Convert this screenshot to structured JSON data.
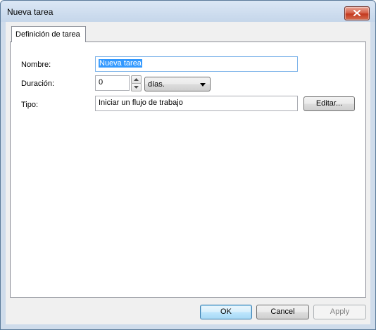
{
  "window": {
    "title": "Nueva tarea"
  },
  "tabs": [
    {
      "label": "Definición de tarea"
    }
  ],
  "form": {
    "nombre_label": "Nombre:",
    "nombre_value": "Nueva tarea",
    "duracion_label": "Duración:",
    "duracion_value": "0",
    "duracion_unit": "días.",
    "tipo_label": "Tipo:",
    "tipo_value": "Iniciar un flujo de trabajo",
    "editar_label": "Editar..."
  },
  "buttons": {
    "ok": "OK",
    "cancel": "Cancel",
    "apply": "Apply"
  },
  "icons": {
    "close": "close-icon",
    "spin_up": "arrow-up-icon",
    "spin_down": "arrow-down-icon",
    "dropdown": "chevron-down-icon"
  },
  "colors": {
    "selection": "#3399ff",
    "close_button": "#c4391f",
    "default_button_border": "#3c7fb1"
  }
}
